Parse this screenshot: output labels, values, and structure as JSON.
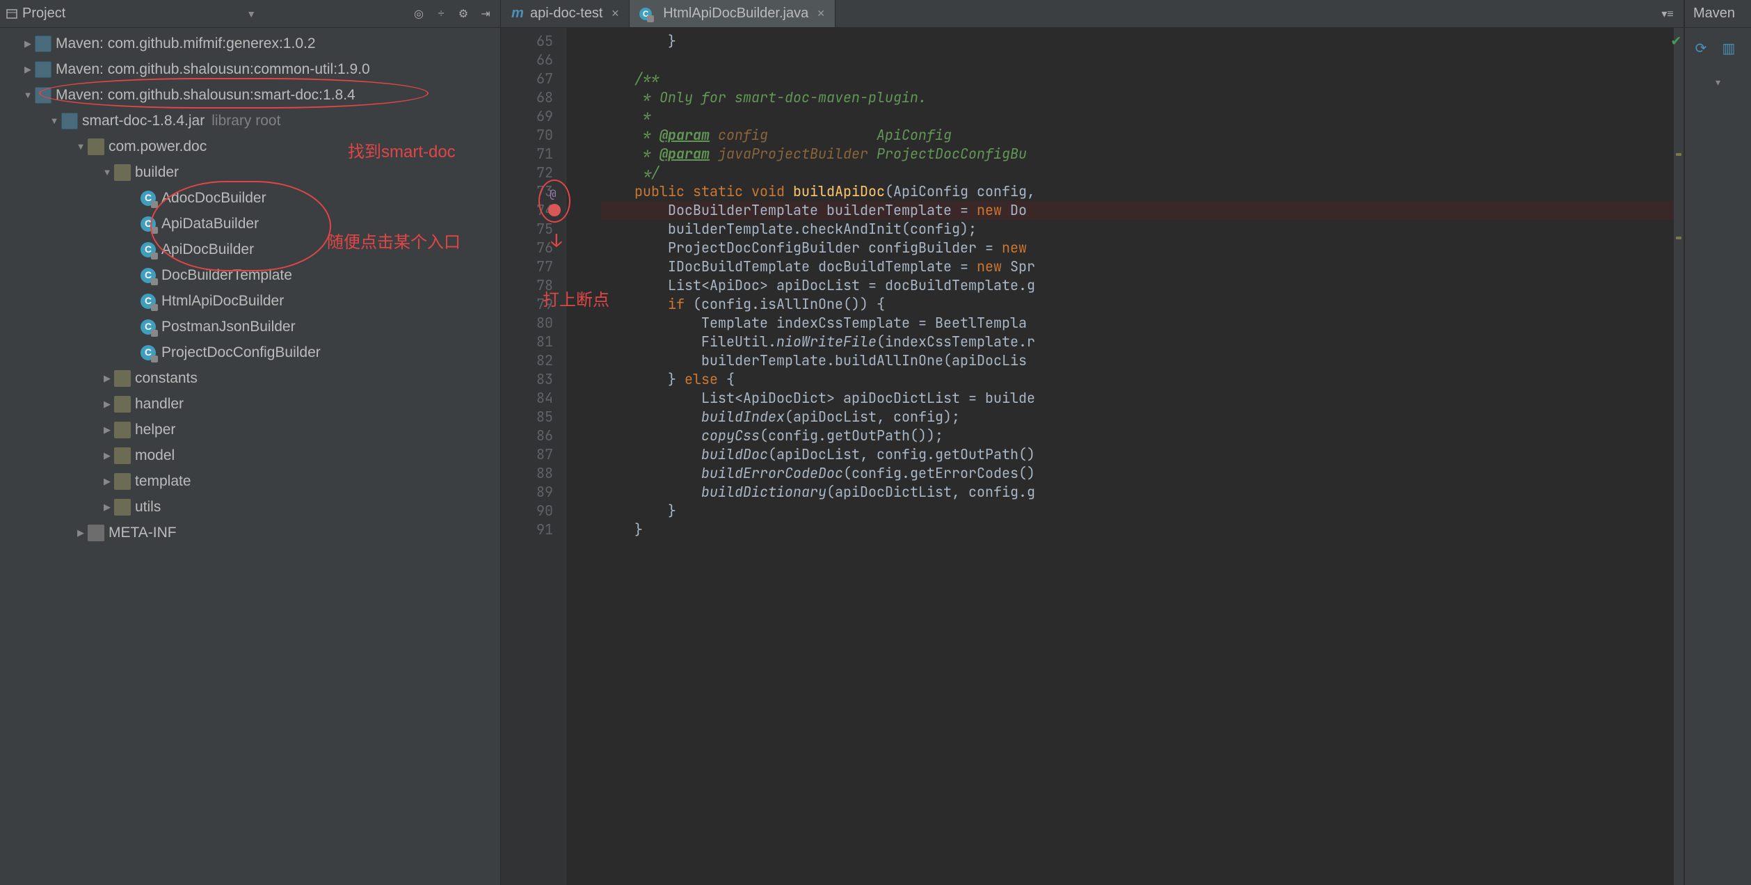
{
  "colors": {
    "annotation": "#e04646",
    "keyword": "#cc7832",
    "method_def": "#ffc66d",
    "doc_comment": "#629755",
    "comment": "#808080",
    "text": "#a9b7c6",
    "breakpoint": "#d95757"
  },
  "project_panel": {
    "title": "Project",
    "toolbar_icons": [
      "target-icon",
      "divide-icon",
      "gear-icon",
      "collapse-icon"
    ],
    "tree": [
      {
        "depth": 0,
        "arrow": "▶",
        "icon": "lib",
        "label": "Maven: com.github.mifmif:generex:1.0.2"
      },
      {
        "depth": 0,
        "arrow": "▶",
        "icon": "lib",
        "label": "Maven: com.github.shalousun:common-util:1.9.0"
      },
      {
        "depth": 0,
        "arrow": "▼",
        "icon": "lib",
        "label": "Maven: com.github.shalousun:smart-doc:1.8.4",
        "circled": true
      },
      {
        "depth": 1,
        "arrow": "▼",
        "icon": "lib",
        "label": "smart-doc-1.8.4.jar",
        "note": "library root"
      },
      {
        "depth": 2,
        "arrow": "▼",
        "icon": "pkg",
        "label": "com.power.doc"
      },
      {
        "depth": 3,
        "arrow": "▼",
        "icon": "pkg",
        "label": "builder"
      },
      {
        "depth": 4,
        "arrow": "",
        "icon": "class",
        "label": "AdocDocBuilder"
      },
      {
        "depth": 4,
        "arrow": "",
        "icon": "class",
        "label": "ApiDataBuilder"
      },
      {
        "depth": 4,
        "arrow": "",
        "icon": "class",
        "label": "ApiDocBuilder"
      },
      {
        "depth": 4,
        "arrow": "",
        "icon": "class",
        "label": "DocBuilderTemplate"
      },
      {
        "depth": 4,
        "arrow": "",
        "icon": "class",
        "label": "HtmlApiDocBuilder"
      },
      {
        "depth": 4,
        "arrow": "",
        "icon": "class",
        "label": "PostmanJsonBuilder"
      },
      {
        "depth": 4,
        "arrow": "",
        "icon": "class",
        "label": "ProjectDocConfigBuilder"
      },
      {
        "depth": 3,
        "arrow": "▶",
        "icon": "pkg",
        "label": "constants"
      },
      {
        "depth": 3,
        "arrow": "▶",
        "icon": "pkg",
        "label": "handler"
      },
      {
        "depth": 3,
        "arrow": "▶",
        "icon": "pkg",
        "label": "helper"
      },
      {
        "depth": 3,
        "arrow": "▶",
        "icon": "pkg",
        "label": "model"
      },
      {
        "depth": 3,
        "arrow": "▶",
        "icon": "pkg",
        "label": "template"
      },
      {
        "depth": 3,
        "arrow": "▶",
        "icon": "pkg",
        "label": "utils"
      },
      {
        "depth": 2,
        "arrow": "▶",
        "icon": "folder",
        "label": "META-INF"
      }
    ],
    "annotations": {
      "find_smart_doc": "找到smart-doc",
      "click_entry": "随便点击某个入口"
    }
  },
  "editor": {
    "tabs": [
      {
        "icon": "m",
        "label": "api-doc-test",
        "active": false
      },
      {
        "icon": "c",
        "label": "HtmlApiDocBuilder.java",
        "active": true
      }
    ],
    "gutter_start": 65,
    "annotation_line": 73,
    "breakpoint_line": 74,
    "annotation_text": "打上断点",
    "lines": [
      {
        "n": 65,
        "html": "        }"
      },
      {
        "n": 66,
        "html": ""
      },
      {
        "n": 67,
        "html": "    <span class='doccm'>/**</span>"
      },
      {
        "n": 68,
        "html": "    <span class='doccm'> * Only for smart-doc-maven-plugin.</span>"
      },
      {
        "n": 69,
        "html": "    <span class='doccm'> *</span>"
      },
      {
        "n": 70,
        "html": "    <span class='doccm'> * <span class='tag'>@param</span> <span class='pn'>config</span>             ApiConfig</span>"
      },
      {
        "n": 71,
        "html": "    <span class='doccm'> * <span class='tag'>@param</span> <span class='pn'>javaProjectBuilder</span> ProjectDocConfigBu</span>"
      },
      {
        "n": 72,
        "html": "    <span class='doccm'> */</span>"
      },
      {
        "n": 73,
        "html": "    <span class='kw'>public</span> <span class='kw'>static</span> <span class='kw'>void</span> <span class='def'>buildApiDoc</span>(ApiConfig config,"
      },
      {
        "n": 74,
        "html": "        DocBuilderTemplate builderTemplate = <span class='kw'>new</span> Do",
        "bp": true
      },
      {
        "n": 75,
        "html": "        builderTemplate.checkAndInit(config);"
      },
      {
        "n": 76,
        "html": "        ProjectDocConfigBuilder configBuilder = <span class='kw'>new</span>"
      },
      {
        "n": 77,
        "html": "        IDocBuildTemplate docBuildTemplate = <span class='kw'>new</span> Spr"
      },
      {
        "n": 78,
        "html": "        List&lt;ApiDoc&gt; apiDocList = docBuildTemplate.g"
      },
      {
        "n": 79,
        "html": "        <span class='kw'>if</span> (config.isAllInOne()) {"
      },
      {
        "n": 80,
        "html": "            Template indexCssTemplate = BeetlTempla"
      },
      {
        "n": 81,
        "html": "            FileUtil.<span class='call-italic'>nioWriteFile</span>(indexCssTemplate.r"
      },
      {
        "n": 82,
        "html": "            builderTemplate.buildAllInOne(apiDocLis"
      },
      {
        "n": 83,
        "html": "        } <span class='kw'>else</span> {"
      },
      {
        "n": 84,
        "html": "            List&lt;ApiDocDict&gt; apiDocDictList = builde"
      },
      {
        "n": 85,
        "html": "            <span class='call-italic'>buildIndex</span>(apiDocList, config);"
      },
      {
        "n": 86,
        "html": "            <span class='call-italic'>copyCss</span>(config.getOutPath());"
      },
      {
        "n": 87,
        "html": "            <span class='call-italic'>buildDoc</span>(apiDocList, config.getOutPath()"
      },
      {
        "n": 88,
        "html": "            <span class='call-italic'>buildErrorCodeDoc</span>(config.getErrorCodes()"
      },
      {
        "n": 89,
        "html": "            <span class='call-italic'>buildDictionary</span>(apiDocDictList, config.g"
      },
      {
        "n": 90,
        "html": "        }"
      },
      {
        "n": 91,
        "html": "    }"
      }
    ]
  },
  "maven": {
    "title": "Maven",
    "tools": [
      "refresh-icon",
      "folder-icon"
    ]
  }
}
